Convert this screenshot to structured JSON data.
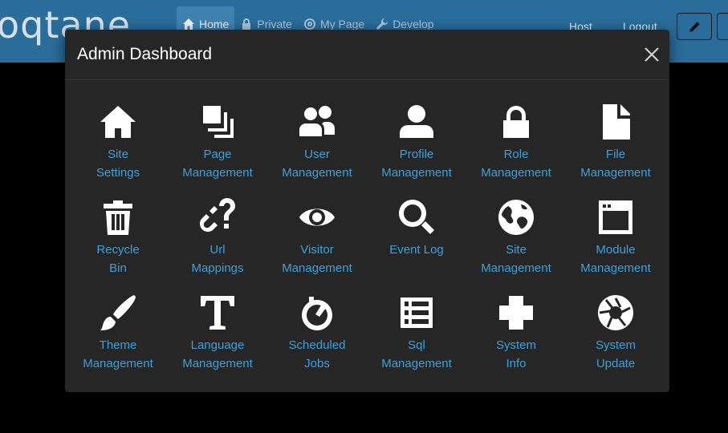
{
  "app": {
    "logo_text": "oqtane"
  },
  "nav": {
    "items": [
      {
        "label": "Home",
        "icon": "home-icon"
      },
      {
        "label": "Private",
        "icon": "lock-icon"
      },
      {
        "label": "My Page",
        "icon": "target-icon"
      },
      {
        "label": "Develop",
        "icon": "wrench-icon"
      }
    ],
    "host_label": "Host",
    "logout_label": "Logout"
  },
  "modal": {
    "title": "Admin Dashboard",
    "tiles": [
      {
        "label": "Site\nSettings",
        "icon": "home-icon"
      },
      {
        "label": "Page\nManagement",
        "icon": "layers-icon"
      },
      {
        "label": "User\nManagement",
        "icon": "people-icon"
      },
      {
        "label": "Profile\nManagement",
        "icon": "person-icon"
      },
      {
        "label": "Role\nManagement",
        "icon": "lock-icon"
      },
      {
        "label": "File\nManagement",
        "icon": "file-icon"
      },
      {
        "label": "Recycle\nBin",
        "icon": "trash-icon"
      },
      {
        "label": "Url\nMappings",
        "icon": "link-question-icon"
      },
      {
        "label": "Visitor\nManagement",
        "icon": "eye-icon"
      },
      {
        "label": "Event Log",
        "icon": "magnifier-icon"
      },
      {
        "label": "Site\nManagement",
        "icon": "globe-icon"
      },
      {
        "label": "Module\nManagement",
        "icon": "browser-window-icon"
      },
      {
        "label": "Theme\nManagement",
        "icon": "brush-icon"
      },
      {
        "label": "Language\nManagement",
        "icon": "text-icon"
      },
      {
        "label": "Scheduled\nJobs",
        "icon": "timer-icon"
      },
      {
        "label": "Sql\nManagement",
        "icon": "list-icon"
      },
      {
        "label": "System\nInfo",
        "icon": "medical-cross-icon"
      },
      {
        "label": "System\nUpdate",
        "icon": "aperture-icon"
      }
    ]
  },
  "colors": {
    "topbar": "#2a6c9a",
    "link": "#3da1db",
    "modal_bg": "#262626"
  }
}
